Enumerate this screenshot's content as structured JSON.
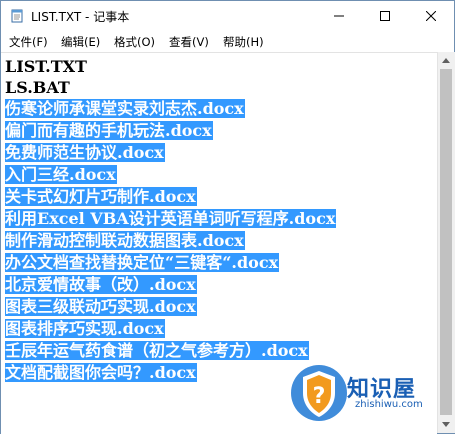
{
  "window": {
    "title": "LIST.TXT - 记事本",
    "controls": {
      "minimize": "—",
      "maximize": "☐",
      "close": "✕"
    }
  },
  "menu": {
    "items": [
      "文件(F)",
      "编辑(E)",
      "格式(O)",
      "查看(V)",
      "帮助(H)"
    ]
  },
  "editor": {
    "lines": [
      {
        "text": "LIST.TXT",
        "selected": false
      },
      {
        "text": "LS.BAT",
        "selected": false
      },
      {
        "text": "伤寒论师承课堂实录刘志杰.docx",
        "selected": true
      },
      {
        "text": "偏门而有趣的手机玩法.docx",
        "selected": true
      },
      {
        "text": "免费师范生协议.docx",
        "selected": true
      },
      {
        "text": "入门三经.docx",
        "selected": true
      },
      {
        "text": "关卡式幻灯片巧制作.docx",
        "selected": true
      },
      {
        "text": "利用Excel VBA设计英语单词听写程序.docx",
        "selected": true
      },
      {
        "text": "制作滑动控制联动数据图表.docx",
        "selected": true
      },
      {
        "text": "办公文档查找替换定位“三键客“.docx",
        "selected": true
      },
      {
        "text": "北京爱情故事（改）.docx",
        "selected": true
      },
      {
        "text": "图表三级联动巧实现.docx",
        "selected": true
      },
      {
        "text": "图表排序巧实现.docx",
        "selected": true
      },
      {
        "text": "壬辰年运气药食谱（初之气参考方）.docx",
        "selected": true
      },
      {
        "text": "文档配截图你会吗？.docx",
        "selected": true
      }
    ],
    "selection_color": "#3399ff"
  },
  "watermark": {
    "name": "知识屋",
    "url": "zhishiwu.com",
    "icon": "question-shield-icon"
  }
}
